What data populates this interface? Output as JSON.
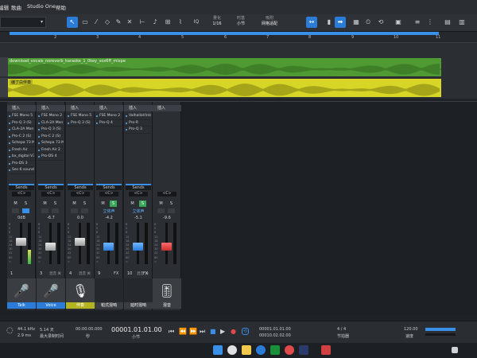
{
  "menu": [
    "编辑",
    "歌曲",
    "音轨",
    "事件",
    "音频",
    "传输",
    "选项",
    "视窗",
    "查看",
    "Studio One",
    "帮助"
  ],
  "toolbar": {
    "quantize": {
      "label": "量化",
      "value": "1/16"
    },
    "timebase": {
      "label": "时基",
      "value": "小节"
    },
    "snap": {
      "label": "吸附",
      "value": "网格适配"
    },
    "iq": "IQ"
  },
  "ruler": {
    "ticks": [
      "2",
      "3",
      "4",
      "5",
      "6",
      "7",
      "8",
      "9",
      "10",
      "11"
    ]
  },
  "tracks": [
    {
      "name": "download_vocals_noreverb_karaoke_1_0key_vox6ff_mixpe",
      "color": "green"
    },
    {
      "name": "编了白伴奏",
      "color": "yellow"
    }
  ],
  "mixer": {
    "insert_header": "插入",
    "channels": [
      {
        "inserts": [
          "FSE Mono 5",
          "Pro-Q 3 (S)",
          "CLA-2A Mon",
          "Pro-C 2 (S)",
          "Schepa 73 M",
          "Fresh Air",
          "bx_digital V3",
          "Pro-DS 3",
          "Sec-6 soundd"
        ],
        "bus": "Sends",
        "pan": "<C>",
        "route": "",
        "volume": "0dB",
        "num": "1",
        "auto": "",
        "name": "Talk",
        "name_color": "#2b7bd8",
        "icon": "mic-icon",
        "glyph": "🎤",
        "fader_level": 0.55,
        "meter_level": 0.35,
        "fader_color": "white",
        "solo": false
      },
      {
        "inserts": [
          "FSE Mono 2",
          "CLA-2A Mon",
          "Pro-Q 3 (S)",
          "Pro-C 2 (S)",
          "Schepa 73 M",
          "Fresh Air 2",
          "Pro-DS 4"
        ],
        "bus": "Sends",
        "pan": "<C>",
        "route": "",
        "volume": "-6.7",
        "num": "3",
        "auto": "混音 关",
        "name": "Voice",
        "name_color": "#2b7bd8",
        "icon": "mic-icon",
        "glyph": "🎤",
        "fader_level": 0.4,
        "meter_level": 0.0,
        "fader_color": "white",
        "solo": false
      },
      {
        "inserts": [
          "FSE Mono 5",
          "Pro-Q 3 (S)"
        ],
        "bus": "Sends",
        "pan": "<C>",
        "route": "",
        "volume": "0.0",
        "num": "4",
        "auto": "混音 关",
        "name": "伴奏",
        "name_color": "#b4b320",
        "icon": "speaker-mic-icon",
        "glyph": "🎙",
        "fader_level": 0.55,
        "meter_level": 0.0,
        "fader_color": "white",
        "solo": false
      },
      {
        "inserts": [
          "FSE Mono 2",
          "Pro-Q 4"
        ],
        "bus": "Sends",
        "pan": "<C>",
        "route": "立体声",
        "volume": "-4.2",
        "num": "9",
        "auto": "",
        "name": "帕式混响",
        "name_color": "#3a3d42",
        "icon": "",
        "glyph": "",
        "fader_level": 0.4,
        "meter_level": 0.0,
        "fader_color": "blue",
        "solo": true
      },
      {
        "inserts": [
          "ValhallaVinta",
          "Pro-R",
          "Pro-Q 3"
        ],
        "bus": "Sends",
        "pan": "<C>",
        "route": "立体声",
        "volume": "-5.1",
        "num": "10",
        "auto": "混音 关",
        "name": "延时混响",
        "name_color": "#3a3d42",
        "icon": "",
        "glyph": "",
        "fader_level": 0.4,
        "meter_level": 0.0,
        "fader_color": "blue",
        "solo": true
      },
      {
        "inserts": [],
        "bus": "",
        "pan": "<C>",
        "route": "",
        "volume": "-9.6",
        "num": "",
        "auto": "",
        "name": "混音",
        "name_color": "#3a3d42",
        "icon": "mixer-icon",
        "glyph": "🎚",
        "fader_level": 0.4,
        "meter_level": 0.0,
        "fader_color": "red",
        "solo": false
      }
    ]
  },
  "transport": {
    "sample_rate": "44.1 kHz",
    "latency": "2.9 ms",
    "record_time": "5.14 天",
    "record_max": "最大录制时间",
    "time_sec": "00:00:00.000",
    "time_label": "秒",
    "position": "00001.01.01.00",
    "position_label": "小节",
    "loop_start": "00001.01.01.00",
    "loop_end": "00010.02.02.00",
    "signature": "4 / 4",
    "signature_label": "节拍器",
    "tempo": "120.00",
    "tempo_label": "速度"
  },
  "colors": {
    "accent": "#2b7bd8",
    "green_track": "#4f9a33",
    "yellow_track": "#d7d626"
  }
}
